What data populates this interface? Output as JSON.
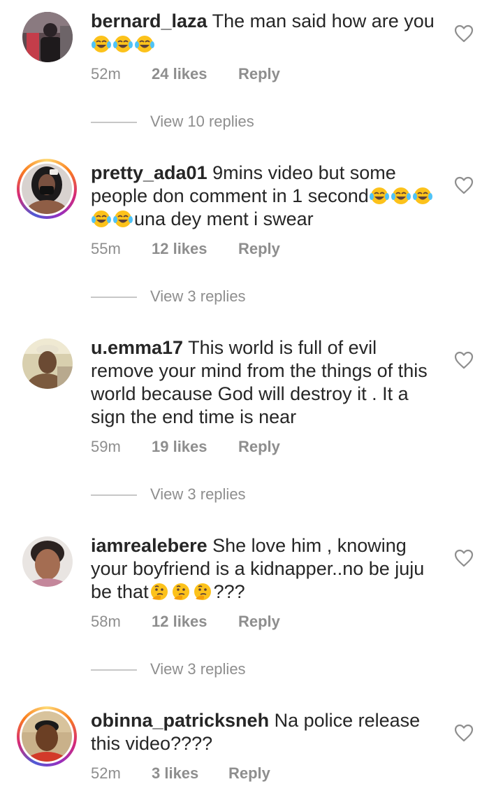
{
  "comments": [
    {
      "username": "bernard_laza",
      "segments": [
        " The man said how are you "
      ],
      "time": "52m",
      "likes": "24 likes",
      "reply": "Reply",
      "view_replies": "View 10 replies",
      "avatar": "avatar-photo",
      "has_story_ring": false
    },
    {
      "username": "pretty_ada01",
      "segments": [
        " 9mins video but some people don comment in 1 second",
        "una dey ment i swear"
      ],
      "time": "55m",
      "likes": "12 likes",
      "reply": "Reply",
      "view_replies": "View 3 replies",
      "avatar": "avatar-photo",
      "has_story_ring": true
    },
    {
      "username": "u.emma17",
      "segments": [
        " This world is full of evil remove your mind from the things of this world because God will destroy it . It a sign the end time is near"
      ],
      "time": "59m",
      "likes": "19 likes",
      "reply": "Reply",
      "view_replies": "View 3 replies",
      "avatar": "avatar-photo",
      "has_story_ring": false
    },
    {
      "username": "iamrealebere",
      "segments": [
        " She love him , knowing your boyfriend is a kidnapper..no be juju be that",
        "???"
      ],
      "time": "58m",
      "likes": "12 likes",
      "reply": "Reply",
      "view_replies": "View 3 replies",
      "avatar": "avatar-photo",
      "has_story_ring": false
    },
    {
      "username": "obinna_patricksneh",
      "segments": [
        " Na police release this video????"
      ],
      "time": "52m",
      "likes": "3 likes",
      "reply": "Reply",
      "avatar": "avatar-photo",
      "has_story_ring": true
    }
  ],
  "icons": {
    "like": "heart-outline-icon",
    "emoji_laugh": "face-with-tears-of-joy",
    "emoji_think": "thinking-face"
  },
  "colors": {
    "text": "#262626",
    "secondary": "#8e8e8e",
    "divider": "#c7c7c7"
  }
}
